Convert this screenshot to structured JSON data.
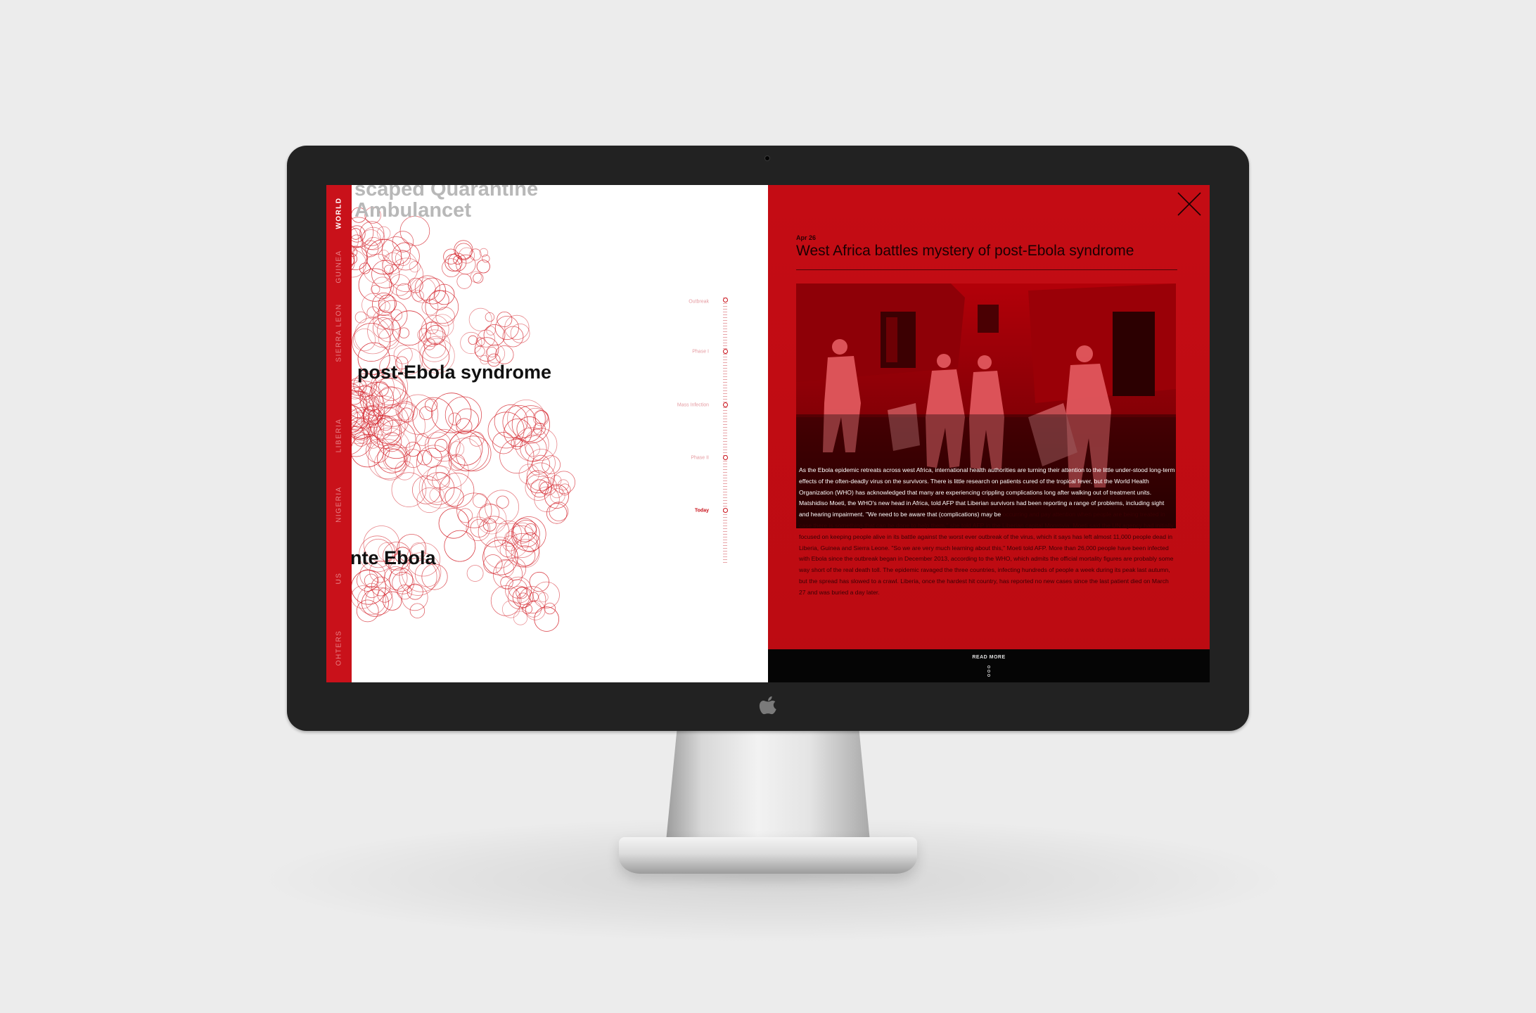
{
  "sidebar": {
    "items": [
      {
        "label": "WORLD",
        "active": true
      },
      {
        "label": "GUINEA",
        "active": false
      },
      {
        "label": "SIERRA LEON",
        "active": false
      },
      {
        "label": "LIBERIA",
        "active": false
      },
      {
        "label": "NIGERIA",
        "active": false
      },
      {
        "label": "US",
        "active": false
      },
      {
        "label": "OHTERS",
        "active": false
      }
    ]
  },
  "left": {
    "headlines": [
      {
        "text": "scaped Quarantine"
      },
      {
        "text": "Ambulancet"
      },
      {
        "text": "post-Ebola syndrome"
      },
      {
        "text": "nte Ebola"
      }
    ]
  },
  "timeline": {
    "labels": [
      "Outbreak",
      "Phase I",
      "Mass Infection",
      "Phase II",
      "Today"
    ],
    "current": "Today"
  },
  "article": {
    "date": "Apr 26",
    "title": "West Africa battles mystery of post-Ebola syndrome",
    "body_bright": "As the Ebola epidemic retreats across west Africa, international health authorities are turning their attention to the little under-stood long-term effects of the often-deadly virus on the survivors. There is little research on patients cured of the tropical fever, but the World Health Organization (WHO) has acknowledged that many are experiencing crippling complications long after walking out of treatment units. Matshidiso Moeti, the WHO's new head in Africa, told AFP that Liberian survivors had been reporting a range of problems, including sight and hearing impairment. \"We need to be aware that (complications) may be",
    "body_dim": "occurring and pay attention when people are being treated in case there is something that can be done to help them,\" she told AFP in the Liberian capital Monrovia. Moeti said the UN agency had initially focused on keeping people alive in its battle against the worst ever outbreak of the virus, which it says has left almost 11,000 people dead in Liberia, Guinea and Sierra Leone. \"So we are very much learning about this,\" Moeti told AFP. More than 26,000 people have been infected with Ebola since the outbreak began in December 2013, according to the WHO, which admits the official mortality figures are probably some way short of the real death toll. The epidemic ravaged the three countries, infecting hundreds of people a week during its peak last autumn, but the spread has slowed to a crawl. Liberia, once the hardest hit country, has reported no new cases since the last patient died on March 27 and was buried a day later.",
    "read_more": "READ MORE"
  },
  "colors": {
    "accent": "#c9111a",
    "panel": "#c40c14",
    "bezel": "#222222",
    "background": "#ececec"
  },
  "icons": {
    "close": "close-x-icon",
    "more": "vertical-dots-icon",
    "logo": "apple-logo-icon"
  }
}
